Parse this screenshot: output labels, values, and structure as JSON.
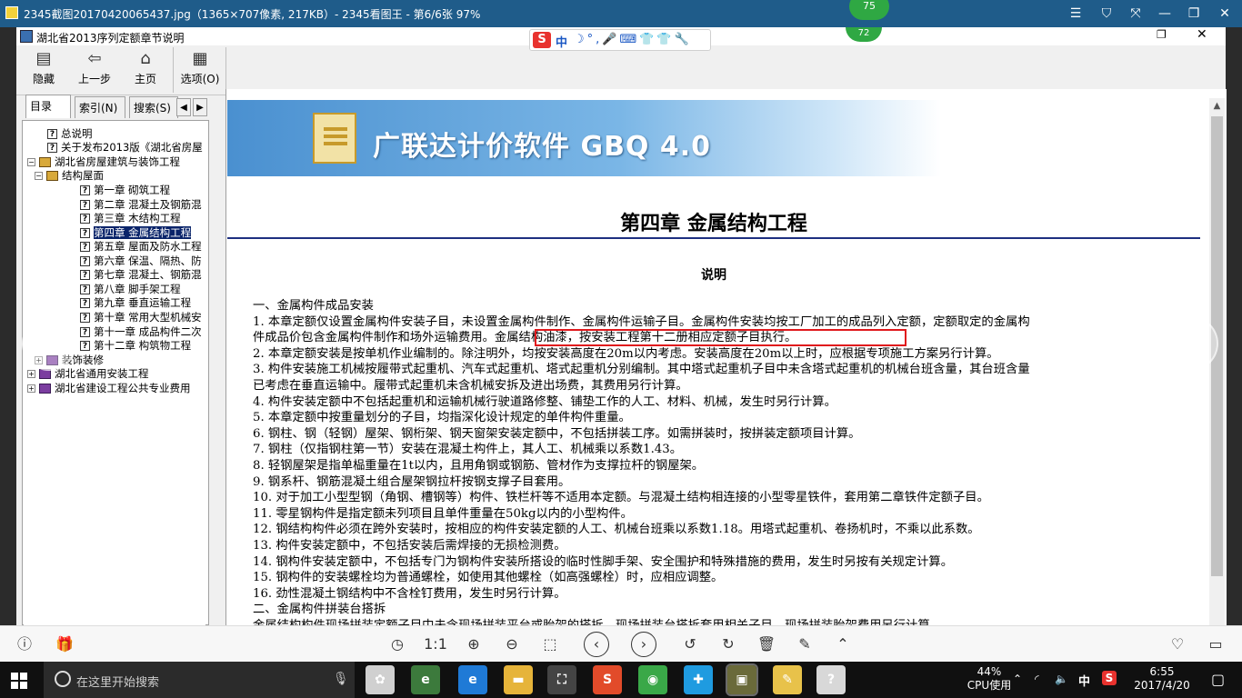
{
  "viewer": {
    "title": "2345截图20170420065437.jpg（1365×707像素, 217KB）- 2345看图王 - 第6/6张 97%",
    "menu_icon": "menu-icon",
    "skin_icon": "shirt-icon",
    "fullscreen_icon": "expand-icon",
    "minimize_icon": "minimize-icon",
    "restore_icon": "restore-icon",
    "close_icon": "close-icon"
  },
  "badges": {
    "top": "75",
    "bottom": "72"
  },
  "help_window": {
    "title": "湖北省2013序列定额章节说明",
    "toolbar": [
      {
        "label": "隐藏",
        "icon": "hide-icon"
      },
      {
        "label": "上一步",
        "icon": "back-arrow-icon"
      },
      {
        "label": "主页",
        "icon": "home-icon"
      },
      {
        "label": "选项(O)",
        "icon": "options-icon"
      }
    ],
    "tabs": [
      "目录(C)",
      "索引(N)",
      "搜索(S)"
    ],
    "tree": [
      {
        "label": "总说明",
        "type": "page",
        "level": 2
      },
      {
        "label": "关于发布2013版《湖北省房屋",
        "type": "page",
        "level": 2
      },
      {
        "label": "湖北省房屋建筑与装饰工程",
        "type": "book-open",
        "level": 0,
        "expander": "⊟"
      },
      {
        "label": "结构屋面",
        "type": "book-open",
        "level": 1,
        "expander": "⊟"
      },
      {
        "label": "第一章 砌筑工程",
        "type": "page",
        "level": 3
      },
      {
        "label": "第二章 混凝土及钢筋混",
        "type": "page",
        "level": 3
      },
      {
        "label": "第三章 木结构工程",
        "type": "page",
        "level": 3
      },
      {
        "label": "第四章 金属结构工程",
        "type": "page",
        "level": 3,
        "selected": true
      },
      {
        "label": "第五章 屋面及防水工程",
        "type": "page",
        "level": 3
      },
      {
        "label": "第六章 保温、隔热、防",
        "type": "page",
        "level": 3
      },
      {
        "label": "第七章 混凝土、钢筋混",
        "type": "page",
        "level": 3
      },
      {
        "label": "第八章 脚手架工程",
        "type": "page",
        "level": 3
      },
      {
        "label": "第九章 垂直运输工程",
        "type": "page",
        "level": 3
      },
      {
        "label": "第十章 常用大型机械安",
        "type": "page",
        "level": 3
      },
      {
        "label": "第十一章 成品构件二次",
        "type": "page",
        "level": 3
      },
      {
        "label": "第十二章 构筑物工程",
        "type": "page",
        "level": 3
      },
      {
        "label": "装饰装修",
        "type": "book",
        "level": 1,
        "expander": "⊞"
      },
      {
        "label": "湖北省通用安装工程",
        "type": "book",
        "level": 0,
        "expander": "⊞"
      },
      {
        "label": "湖北省建设工程公共专业费用",
        "type": "book",
        "level": 0,
        "expander": "⊞"
      }
    ]
  },
  "ime": {
    "logo": "S",
    "mode": "中",
    "tools": "☽°,🎤⌨👕👕🔧"
  },
  "banner": {
    "title": "广联达计价软件 GBQ 4.0"
  },
  "document": {
    "chapter_title": "第四章  金属结构工程",
    "subtitle": "说明",
    "lines": [
      "一、金属构件成品安装",
      "1. 本章定额仅设置金属构件安装子目，未设置金属构件制作、金属构件运输子目。金属构件安装均按工厂加工的成品列入定额，定额取定的金属构",
      "件成品价包含金属构件制作和场外运输费用。金属结构油漆，按安装工程第十二册相应定额子目执行。",
      "2. 本章定额安装是按单机作业编制的。除注明外，均按安装高度在20m以内考虑。安装高度在20m以上时，应根据专项施工方案另行计算。",
      "3. 构件安装施工机械按履带式起重机、汽车式起重机、塔式起重机分别编制。其中塔式起重机子目中未含塔式起重机的机械台班含量，其台班含量",
      "已考虑在垂直运输中。履带式起重机未含机械安拆及进出场费，其费用另行计算。",
      "4. 构件安装定额中不包括起重机和运输机械行驶道路修整、铺垫工作的人工、材料、机械，发生时另行计算。",
      "5. 本章定额中按重量划分的子目，均指深化设计规定的单件构件重量。",
      "6. 钢柱、钢（轻钢）屋架、钢桁架、钢天窗架安装定额中，不包括拼装工序。如需拼装时，按拼装定额项目计算。",
      "7. 钢柱（仅指钢柱第一节）安装在混凝土构件上，其人工、机械乘以系数1.43。",
      "8. 轻钢屋架是指单榀重量在1t以内，且用角钢或钢筋、管材作为支撑拉杆的钢屋架。",
      "9. 钢系杆、钢筋混凝土组合屋架钢拉杆按钢支撑子目套用。",
      "10. 对于加工小型型钢（角钢、槽钢等）构件、铁栏杆等不适用本定额。与混凝土结构相连接的小型零星铁件，套用第二章铁件定额子目。",
      "11. 零星钢构件是指定额未列项目且单件重量在50kg以内的小型构件。",
      "12. 钢结构构件必须在跨外安装时，按相应的构件安装定额的人工、机械台班乘以系数1.18。用塔式起重机、卷扬机时，不乘以此系数。",
      "13. 构件安装定额中，不包括安装后需焊接的无损检测费。",
      "14. 钢构件安装定额中，不包括专门为钢构件安装所搭设的临时性脚手架、安全围护和特殊措施的费用，发生时另按有关规定计算。",
      "15. 钢构件的安装螺栓均为普通螺栓，如使用其他螺栓（如高强螺栓）时，应相应调整。",
      "16. 劲性混凝土钢结构中不含栓钉费用，发生时另行计算。",
      "二、金属构件拼装台搭拆",
      "金属结构构件现场拼装定额子目中未含现场拼装平台或胎架的搭拆，现场拼装台搭拆套用相关子目，现场拼装胎架费用另行计算。"
    ]
  },
  "bottom_toolbar": {
    "left": [
      {
        "icon": "info-icon",
        "glyph": "ⓘ"
      },
      {
        "icon": "gift-icon",
        "glyph": "🎁"
      }
    ],
    "center": [
      {
        "icon": "rotate-view-icon",
        "glyph": "◷"
      },
      {
        "icon": "actual-size-icon",
        "glyph": "1:1"
      },
      {
        "icon": "zoom-in-icon",
        "glyph": "⊕"
      },
      {
        "icon": "zoom-out-icon",
        "glyph": "⊖"
      },
      {
        "icon": "pin-icon",
        "glyph": "⬚"
      },
      {
        "icon": "prev-image-icon",
        "glyph": "‹"
      },
      {
        "icon": "next-image-icon",
        "glyph": "›"
      },
      {
        "icon": "rotate-left-icon",
        "glyph": "↺"
      },
      {
        "icon": "rotate-right-icon",
        "glyph": "↻"
      },
      {
        "icon": "delete-icon",
        "glyph": "🗑"
      },
      {
        "icon": "edit-icon",
        "glyph": "✎"
      },
      {
        "icon": "up-icon",
        "glyph": "⌃"
      }
    ],
    "right": [
      {
        "icon": "heart-icon",
        "glyph": "♡"
      },
      {
        "icon": "folder-icon",
        "glyph": "▭"
      }
    ]
  },
  "taskbar": {
    "search_placeholder": "在这里开始搜索",
    "apps": [
      {
        "icon": "photos-icon",
        "color": "#d0d0d0"
      },
      {
        "icon": "2345-browser-icon",
        "color": "#3c7a3c"
      },
      {
        "icon": "edge-icon",
        "color": "#1f7ad6"
      },
      {
        "icon": "file-explorer-icon",
        "color": "#e6b43a"
      },
      {
        "icon": "store-icon",
        "color": "#444444"
      },
      {
        "icon": "sogou-icon",
        "color": "#e24b2a"
      },
      {
        "icon": "360-icon",
        "color": "#3aa848"
      },
      {
        "icon": "qq-icon",
        "color": "#1f9be0"
      },
      {
        "icon": "image-viewer-icon",
        "color": "#6a6a3a"
      },
      {
        "icon": "notepad-icon",
        "color": "#e8c24a"
      },
      {
        "icon": "help-icon",
        "color": "#d8d8d8"
      }
    ],
    "cpu_percent": "44%",
    "cpu_label": "CPU使用",
    "ime_indicator": "中",
    "time": "6:55",
    "date": "2017/4/20"
  }
}
